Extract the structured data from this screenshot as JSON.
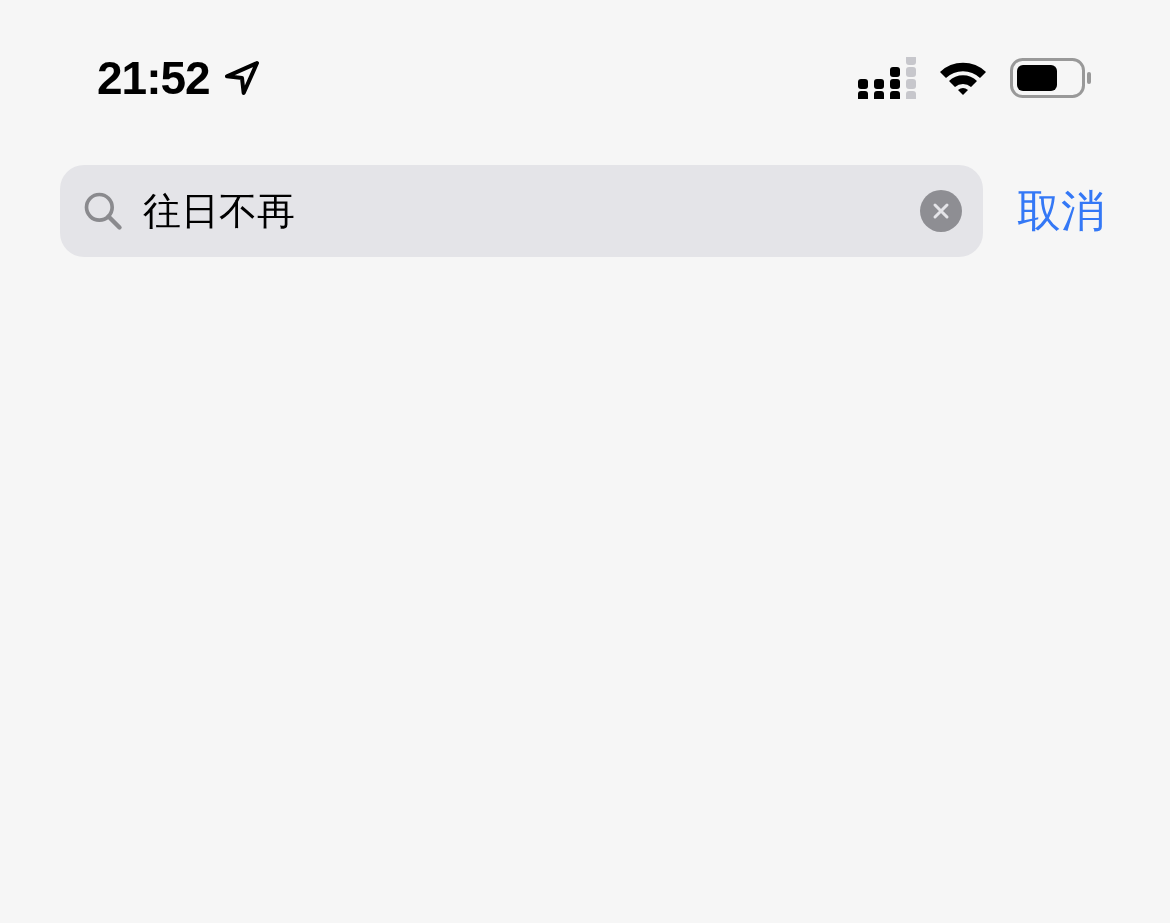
{
  "status_bar": {
    "time": "21:52"
  },
  "search": {
    "value": "往日不再"
  },
  "cancel_button": {
    "label": "取消"
  }
}
